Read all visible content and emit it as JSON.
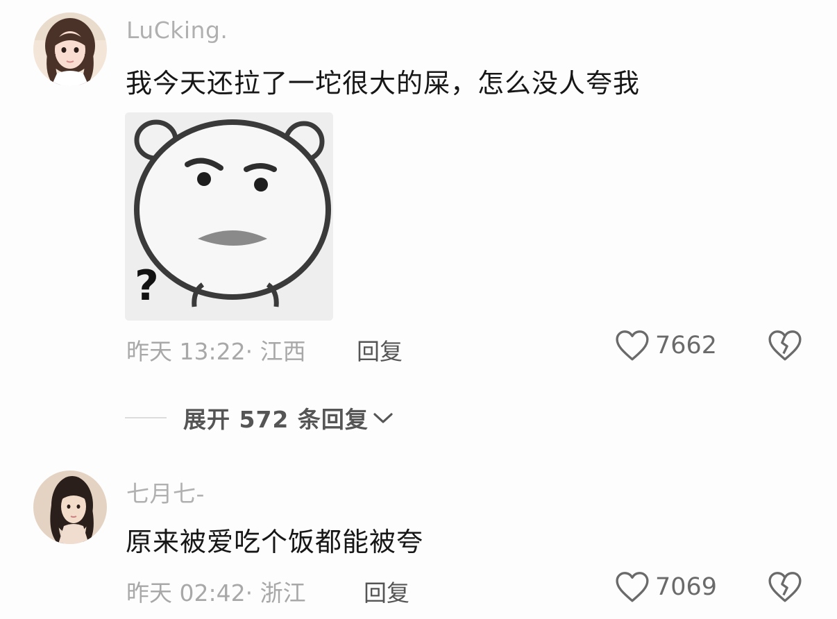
{
  "comments": [
    {
      "username": "LuCking.",
      "text": "我今天还拉了一坨很大的屎，怎么没人夸我",
      "sticker": "bear-face-question-sticker",
      "meta": "昨天 13:22· 江西",
      "reply_label": "回复",
      "like_count": "7662",
      "expand_label": "展开 572 条回复"
    },
    {
      "username": "七月七-",
      "text": "原来被爱吃个饭都能被夸",
      "meta": "昨天 02:42· 浙江",
      "reply_label": "回复",
      "like_count": "7069"
    }
  ],
  "icons": {
    "like": "heart-outline-icon",
    "dislike": "broken-heart-icon",
    "expand": "chevron-down-icon"
  },
  "colors": {
    "username": "#b0b0b0",
    "text": "#161616",
    "meta": "#a8a8a8",
    "icon": "#6a6a6a"
  }
}
